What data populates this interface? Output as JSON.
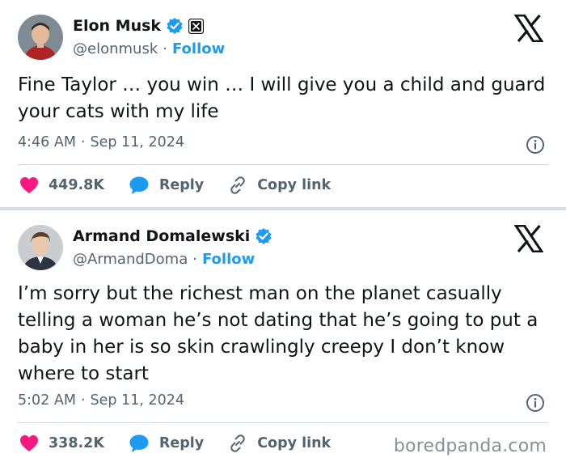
{
  "tweets": [
    {
      "name": "Elon Musk",
      "handle": "@elonmusk",
      "follow_label": "Follow",
      "separator": "·",
      "text": "Fine Taylor … you win … I will give you a child and guard your cats with my life",
      "time": "4:46 AM",
      "date": "Sep 11, 2024",
      "likes": "449.8K",
      "reply_label": "Reply",
      "copy_label": "Copy link",
      "has_x_badge": true
    },
    {
      "name": "Armand Domalewski",
      "handle": "@ArmandDoma",
      "follow_label": "Follow",
      "separator": "·",
      "text": "I’m sorry but the richest man on the planet casually telling a woman he’s not dating that he’s going to put a baby in her is so skin crawlingly creepy I don’t know where to start",
      "time": "5:02 AM",
      "date": "Sep 11, 2024",
      "likes": "338.2K",
      "reply_label": "Reply",
      "copy_label": "Copy link",
      "has_x_badge": false
    }
  ],
  "watermark": "boredpanda.com",
  "colors": {
    "link": "#1d9bf0",
    "like": "#f91880",
    "muted": "#536471",
    "text": "#0f1419",
    "verified": "#1d9bf0"
  },
  "icons": [
    "verified-badge-icon",
    "x-affiliate-badge-icon",
    "x-logo-icon",
    "heart-icon",
    "reply-bubble-icon",
    "link-icon",
    "info-icon"
  ]
}
